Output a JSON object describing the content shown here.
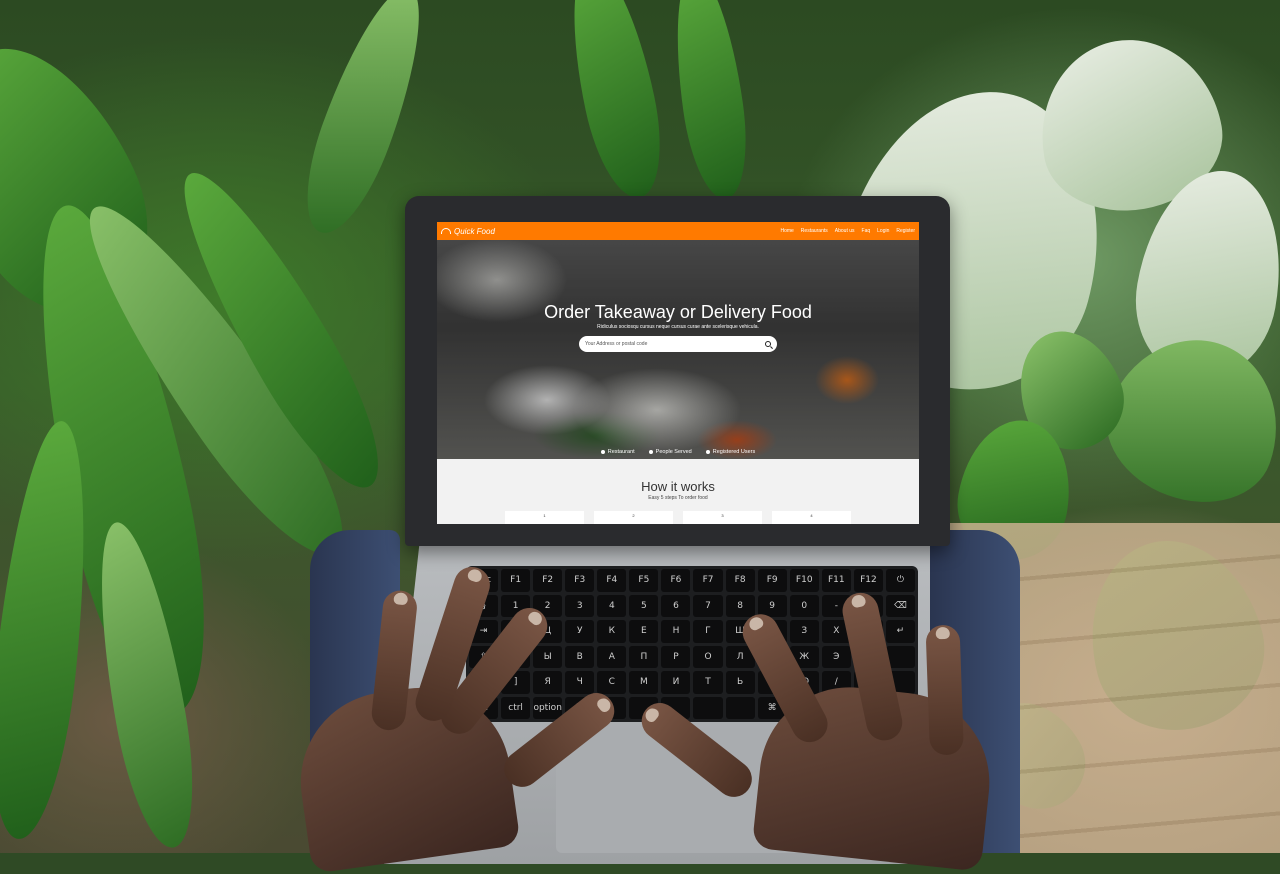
{
  "site": {
    "brand": "Quick Food",
    "nav": [
      "Home",
      "Restaurants",
      "About us",
      "Faq",
      "Login",
      "Register"
    ],
    "hero": {
      "title": "Order Takeaway or Delivery Food",
      "subtitle": "Ridiculus sociosqu cursus neque cursus curae ante scelerisque vehicula.",
      "search_placeholder": "Your Address or postal code"
    },
    "stats": [
      "Restaurant",
      "People Served",
      "Registered Users"
    ],
    "how_it_works": {
      "title": "How it works",
      "subtitle": "Easy 5 steps To order food",
      "steps": [
        "1",
        "2",
        "3",
        "4"
      ]
    }
  },
  "keyboard": {
    "rows": [
      [
        "esc",
        "F1",
        "F2",
        "F3",
        "F4",
        "F5",
        "F6",
        "F7",
        "F8",
        "F9",
        "F10",
        "F11",
        "F12",
        "⏻"
      ],
      [
        "§",
        "1",
        "2",
        "3",
        "4",
        "5",
        "6",
        "7",
        "8",
        "9",
        "0",
        "-",
        "=",
        "⌫"
      ],
      [
        "⇥",
        "Й",
        "Ц",
        "У",
        "К",
        "Е",
        "Н",
        "Г",
        "Ш",
        "Щ",
        "З",
        "Х",
        "Ъ",
        "↵"
      ],
      [
        "⇪",
        "Ф",
        "Ы",
        "В",
        "А",
        "П",
        "Р",
        "О",
        "Л",
        "Д",
        "Ж",
        "Э",
        "Ё",
        ""
      ],
      [
        "⇧",
        "]",
        "Я",
        "Ч",
        "С",
        "М",
        "И",
        "Т",
        "Ь",
        "Б",
        "Ю",
        "/",
        "⇧",
        ""
      ],
      [
        "fn",
        "ctrl",
        "option",
        "⌘",
        "",
        "",
        "",
        "",
        "",
        "⌘",
        "option",
        "◀",
        "▼",
        "▶"
      ]
    ]
  },
  "colors": {
    "accent": "#ff7a00"
  }
}
